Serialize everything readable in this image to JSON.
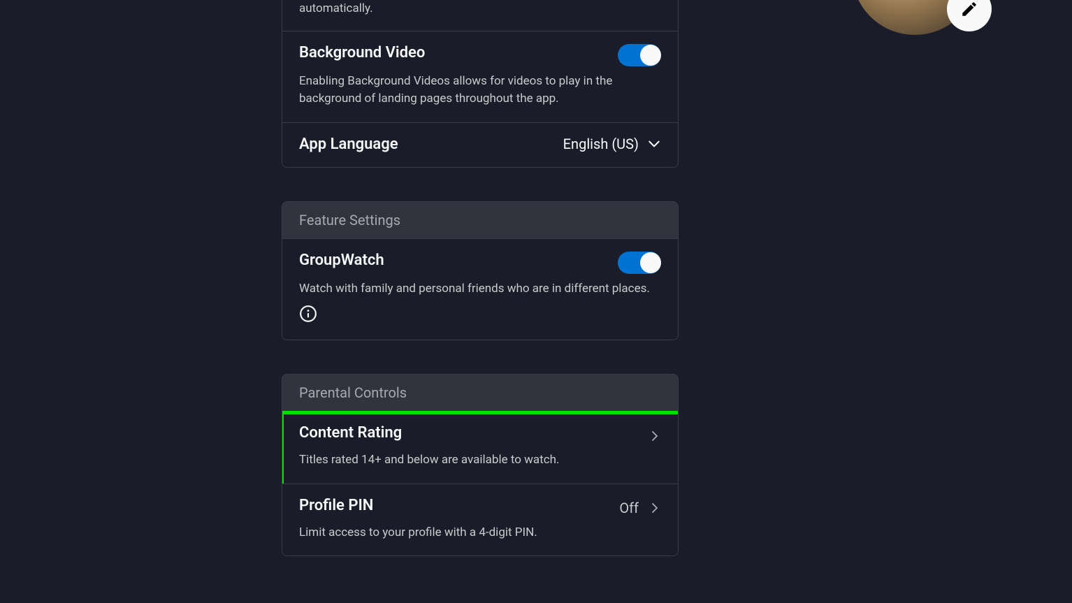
{
  "playback": {
    "autoplay_desc_partial": "automatically.",
    "bgvideo_title": "Background Video",
    "bgvideo_desc": "Enabling Background Videos allows for videos to play in the background of landing pages throughout the app.",
    "language_title": "App Language",
    "language_value": "English (US)"
  },
  "feature": {
    "header": "Feature Settings",
    "groupwatch_title": "GroupWatch",
    "groupwatch_desc": "Watch with family and personal friends who are in different places."
  },
  "parental": {
    "header": "Parental Controls",
    "content_rating_title": "Content Rating",
    "content_rating_desc": "Titles rated 14+ and below are available to watch.",
    "profile_pin_title": "Profile PIN",
    "profile_pin_value": "Off",
    "profile_pin_desc": "Limit access to your profile with a 4-digit PIN."
  }
}
